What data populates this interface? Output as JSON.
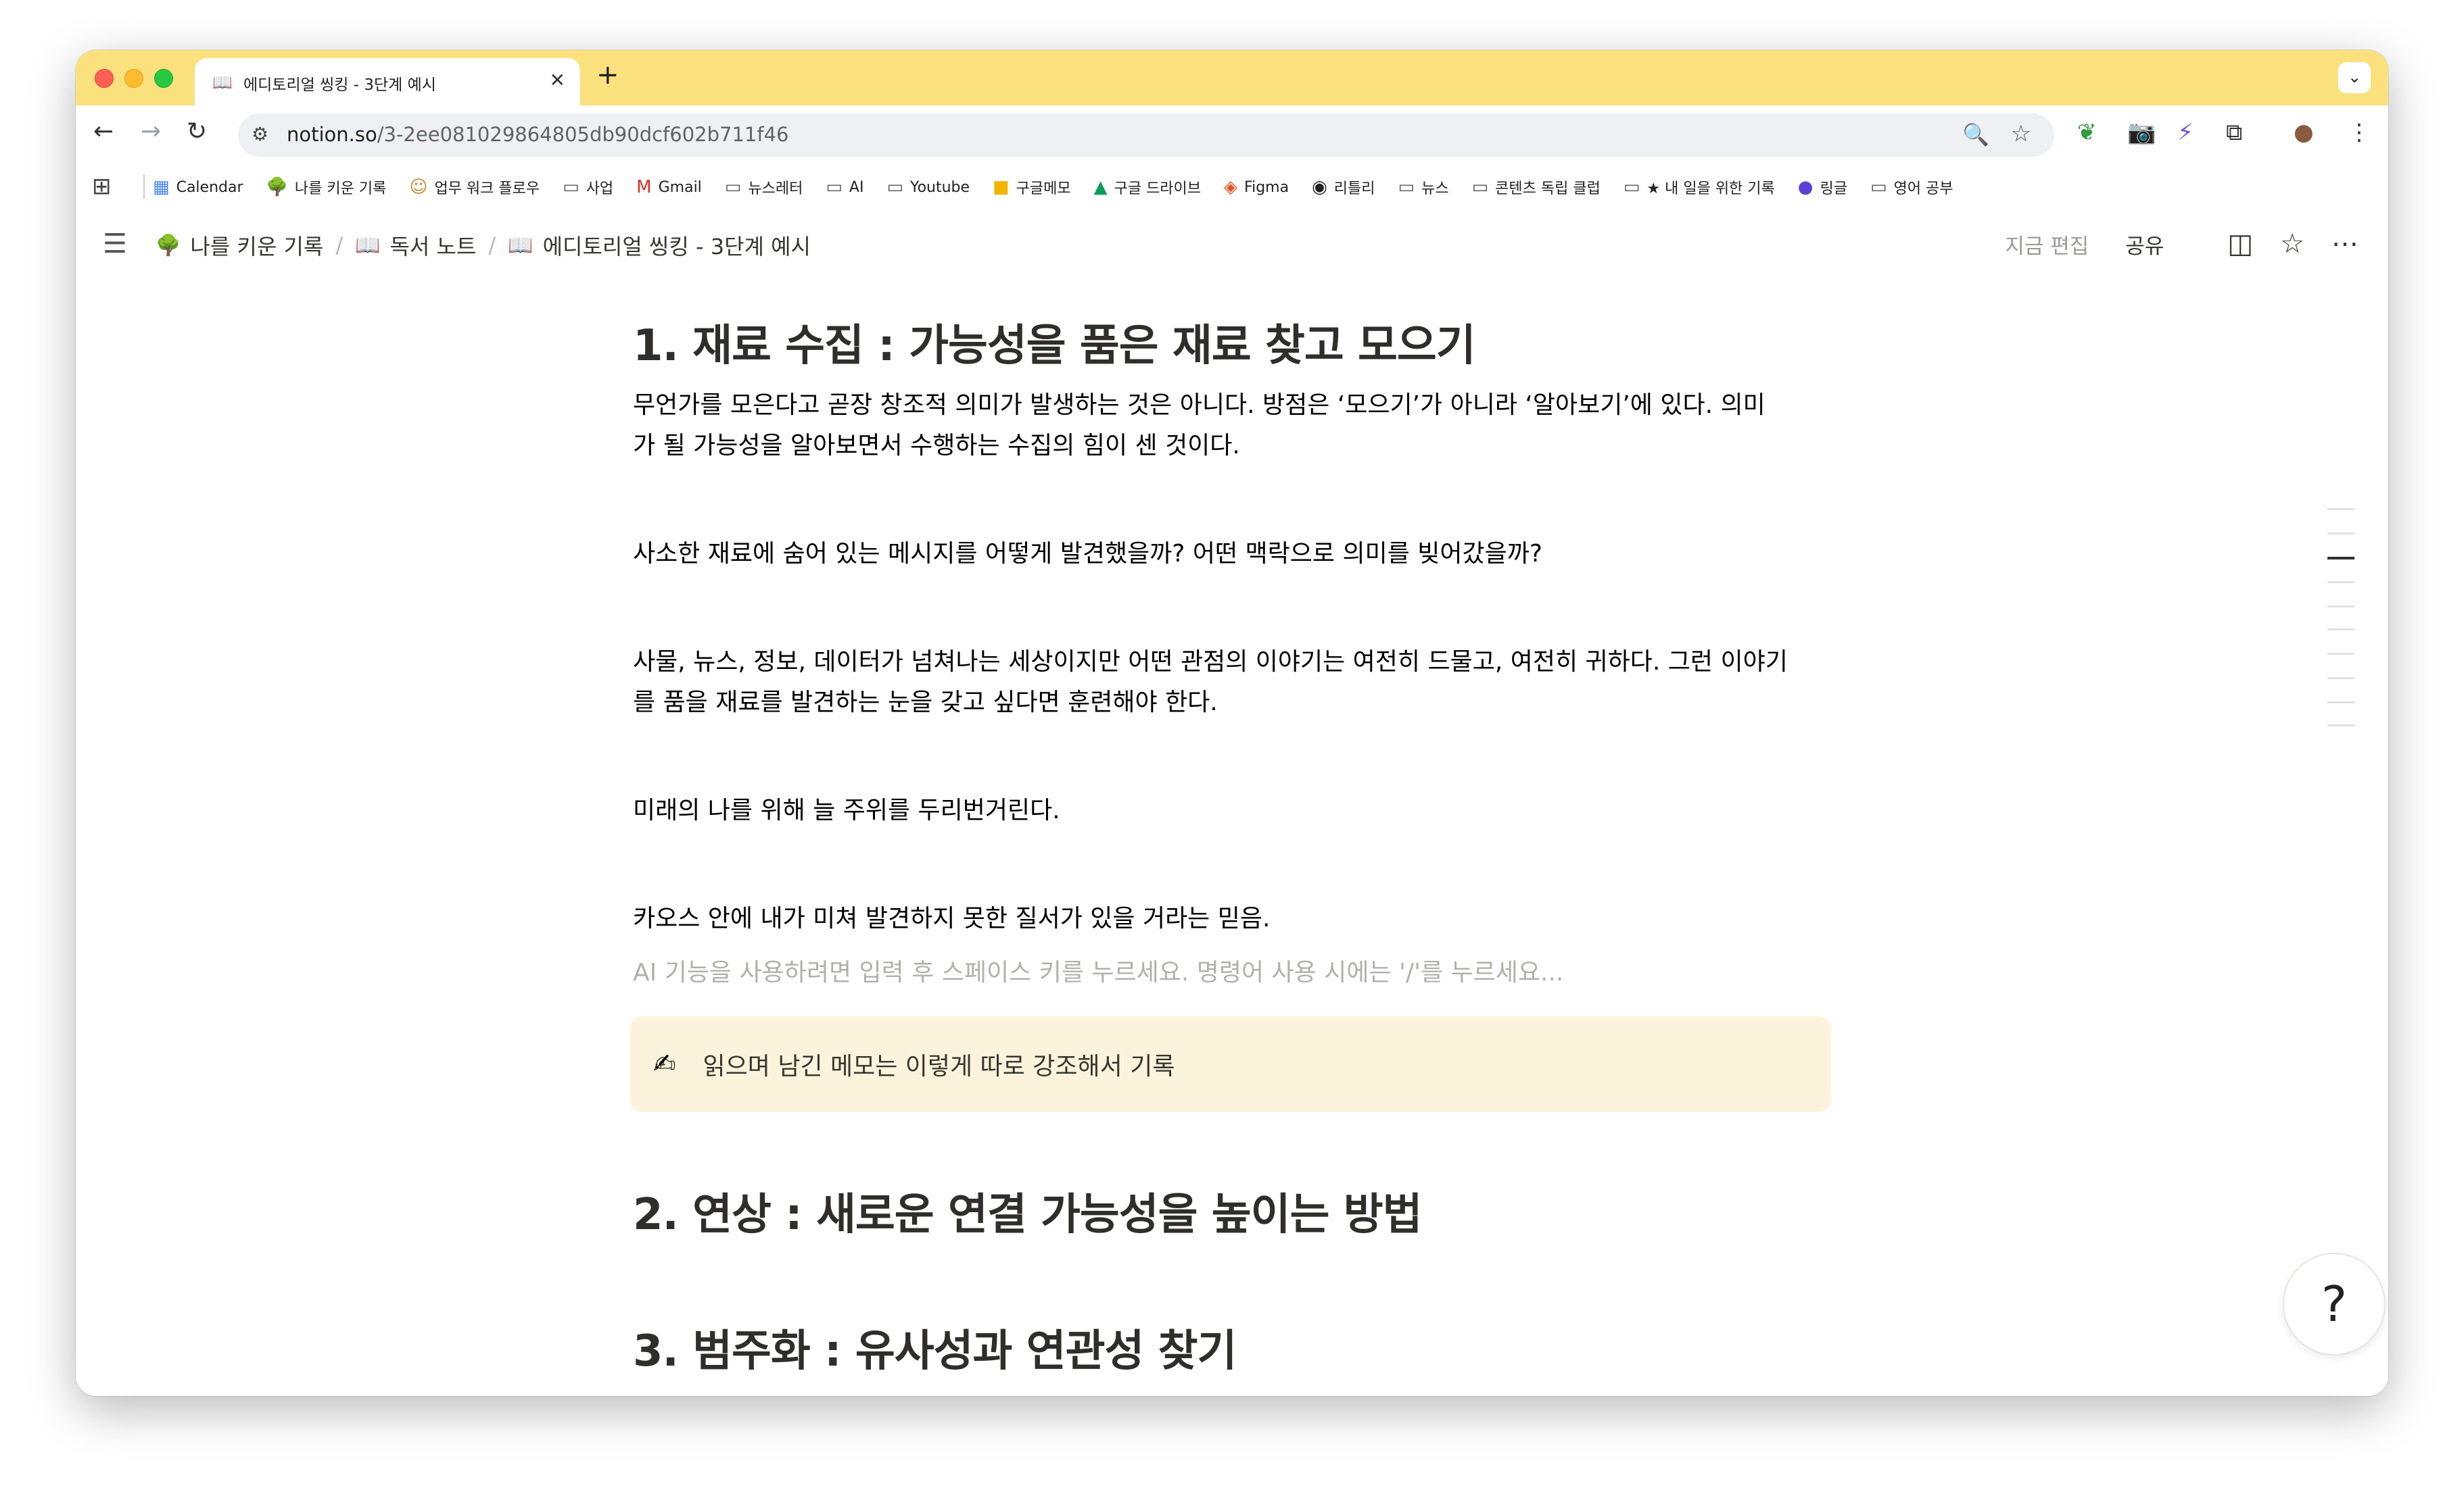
{
  "browser": {
    "tab": {
      "icon": "book-icon",
      "title": "에디토리얼 씽킹 - 3단계 예시"
    },
    "url": {
      "domain": "notion.so",
      "path": "/3-2ee081029864805db90dcf602b711f46"
    }
  },
  "bookmarks": [
    {
      "label": "Calendar",
      "icon": "calendar-icon"
    },
    {
      "label": "나를 키운 기록",
      "icon": "tree-icon"
    },
    {
      "label": "업무 워크 플로우",
      "icon": "person-icon"
    },
    {
      "label": "사업",
      "icon": "folder-icon"
    },
    {
      "label": "Gmail",
      "icon": "gmail-icon"
    },
    {
      "label": "뉴스레터",
      "icon": "folder-icon"
    },
    {
      "label": "AI",
      "icon": "folder-icon"
    },
    {
      "label": "Youtube",
      "icon": "folder-icon"
    },
    {
      "label": "구글메모",
      "icon": "keep-icon"
    },
    {
      "label": "구글 드라이브",
      "icon": "drive-icon"
    },
    {
      "label": "Figma",
      "icon": "figma-icon"
    },
    {
      "label": "리틀리",
      "icon": "littly-icon"
    },
    {
      "label": "뉴스",
      "icon": "folder-icon"
    },
    {
      "label": "콘텐츠 독립 클럽",
      "icon": "folder-icon"
    },
    {
      "label": "★ 내 일을 위한 기록",
      "icon": "folder-icon"
    },
    {
      "label": "링글",
      "icon": "ringle-icon"
    },
    {
      "label": "영어 공부",
      "icon": "folder-icon"
    }
  ],
  "notion": {
    "breadcrumb": [
      {
        "label": "나를 키운 기록",
        "icon": "tree-icon"
      },
      {
        "label": "독서 노트",
        "icon": "book-icon"
      },
      {
        "label": "에디토리얼 씽킹 - 3단계 예시",
        "icon": "book-icon"
      }
    ],
    "edit_status": "지금 편집",
    "share_label": "공유"
  },
  "page": {
    "heading1": "1. 재료 수집 : 가능성을 품은 재료 찾고 모으기",
    "para1_line1": "무언가를 모은다고 곧장 창조적 의미가 발생하는 것은 아니다. 방점은 ‘모으기’가 아니라 ‘알아보기’에 있다. 의미",
    "para1_line2": "가 될 가능성을 알아보면서 수행하는 수집의 힘이 센 것이다.",
    "para2": "사소한 재료에 숨어 있는 메시지를 어떻게 발견했을까? 어떤 맥락으로 의미를 빚어갔을까?",
    "para3_line1": "사물, 뉴스, 정보, 데이터가 넘쳐나는 세상이지만 어떤 관점의 이야기는 여전히 드물고, 여전히 귀하다. 그런 이야기",
    "para3_line2": "를 품을 재료를 발견하는 눈을 갖고 싶다면 훈련해야 한다.",
    "para4": "미래의 나를 위해 늘 주위를 두리번거린다.",
    "para5": "카오스 안에 내가 미쳐 발견하지 못한 질서가 있을 거라는 믿음.",
    "ai_placeholder": "AI 기능을 사용하려면 입력 후 스페이스 키를 누르세요. 명령어 사용 시에는 '/'를 누르세요...",
    "callout": {
      "icon": "writing-hand-icon",
      "text": "읽으며 남긴 메모는 이렇게 따로 강조해서 기록"
    },
    "heading2": "2. 연상 : 새로운 연결 가능성을 높이는 방법",
    "heading3": "3. 범주화 : 유사성과 연관성 찾기"
  },
  "colors": {
    "tabstrip": "#fbe07e",
    "callout_bg": "#fbf3db",
    "text": "#37352f"
  }
}
